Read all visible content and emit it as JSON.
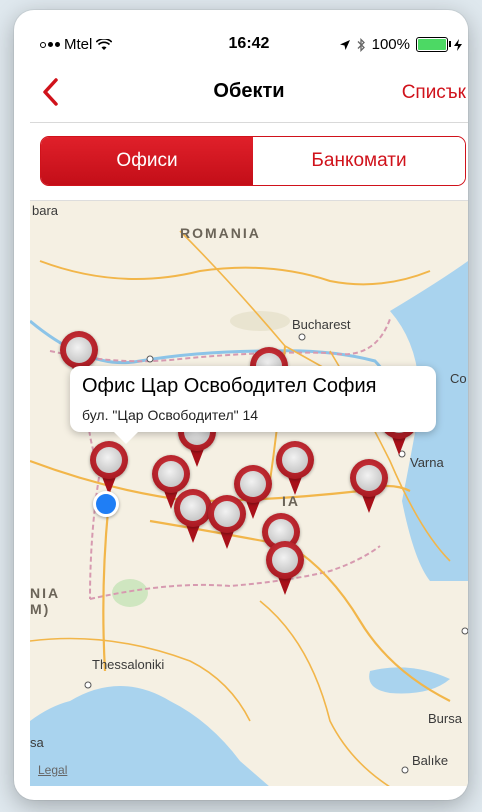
{
  "status_bar": {
    "carrier": "Mtel",
    "time": "16:42",
    "battery": "100%",
    "battery_level": 1.0
  },
  "nav": {
    "title": "Обекти",
    "right_action": "Списък"
  },
  "segments": [
    {
      "label": "Офиси",
      "active": true
    },
    {
      "label": "Банкомати",
      "active": false
    }
  ],
  "map": {
    "labels": {
      "country_romania": "ROMANIA",
      "country_bulgaria_fragment": "IA",
      "city_bucharest": "Bucharest",
      "city_varna": "Varna",
      "city_thessaloniki": "Thessaloniki",
      "fragment_left_top": "bara",
      "fragment_left_mid_1": "NIA",
      "fragment_left_mid_2": "M)",
      "fragment_right_co": "Co",
      "fragment_bursa": "Bursa",
      "fragment_balikesir": "Balıke",
      "fragment_left_bottom": "sa"
    },
    "legal": "Legal",
    "callout": {
      "title": "Офис Цар Освободител София",
      "subtitle": "бул. \"Цар Освободител\" 14"
    }
  },
  "colors": {
    "accent": "#d0121b",
    "pin": "#b31a22",
    "user_location": "#1f7ef5",
    "sea": "#a9d3ee",
    "land": "#f5f0e3"
  }
}
